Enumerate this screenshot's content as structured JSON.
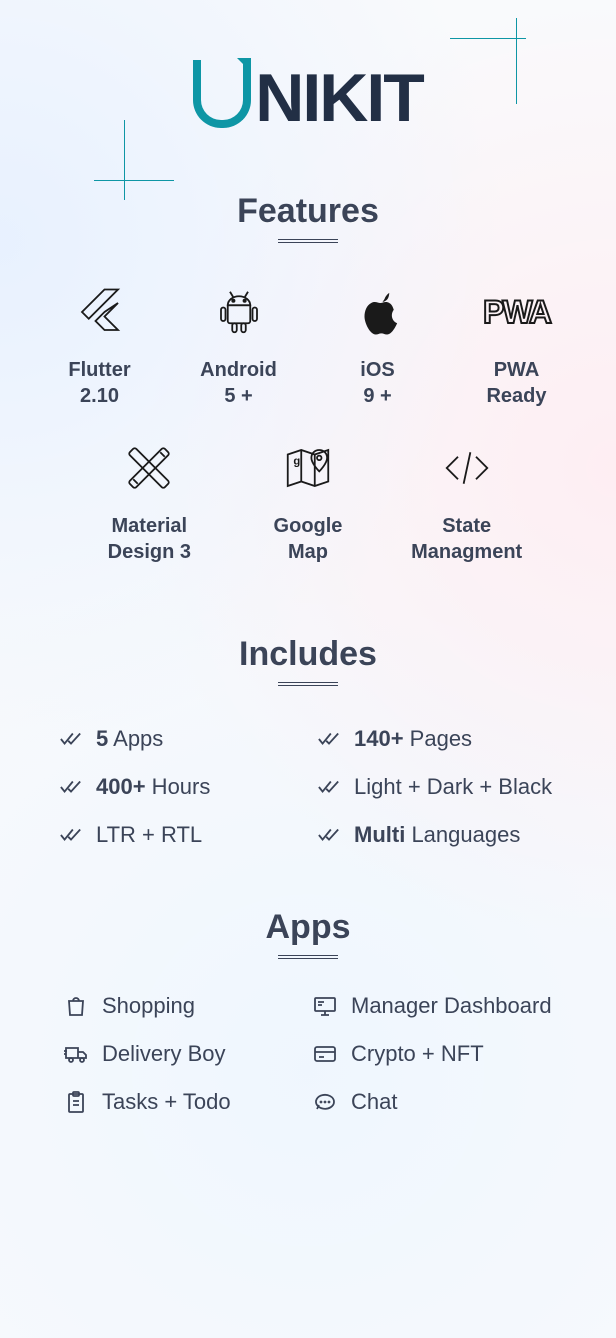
{
  "logo": {
    "brand_text": "NIKIT"
  },
  "sections": {
    "features_title": "Features",
    "includes_title": "Includes",
    "apps_title": "Apps"
  },
  "features": [
    {
      "icon": "flutter",
      "line1": "Flutter",
      "line2": "2.10"
    },
    {
      "icon": "android",
      "line1": "Android",
      "line2": "5 +"
    },
    {
      "icon": "apple",
      "line1": "iOS",
      "line2": "9 +"
    },
    {
      "icon": "pwa",
      "line1": "PWA",
      "line2": "Ready"
    },
    {
      "icon": "design",
      "line1": "Material",
      "line2": "Design 3"
    },
    {
      "icon": "map",
      "line1": "Google",
      "line2": "Map"
    },
    {
      "icon": "code",
      "line1": "State",
      "line2": "Managment"
    }
  ],
  "includes": [
    {
      "bold": "5",
      "rest": " Apps"
    },
    {
      "bold": "140+",
      "rest": " Pages"
    },
    {
      "bold": "400+",
      "rest": " Hours"
    },
    {
      "bold": "",
      "rest": "Light + Dark + Black"
    },
    {
      "bold": "",
      "rest": "LTR + RTL"
    },
    {
      "bold": "Multi",
      "rest": " Languages"
    }
  ],
  "apps": [
    {
      "icon": "bag",
      "label": "Shopping"
    },
    {
      "icon": "dashboard",
      "label": "Manager Dashboard"
    },
    {
      "icon": "truck",
      "label": "Delivery Boy"
    },
    {
      "icon": "card",
      "label": "Crypto + NFT"
    },
    {
      "icon": "clipboard",
      "label": "Tasks + Todo"
    },
    {
      "icon": "chat",
      "label": "Chat"
    }
  ]
}
